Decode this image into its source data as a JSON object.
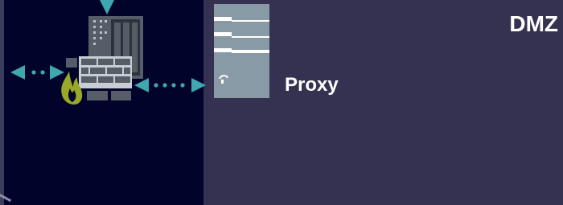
{
  "zones": {
    "internal": {
      "background": "#02032a"
    },
    "dmz": {
      "label": "DMZ",
      "background": "#343250"
    }
  },
  "nodes": {
    "firewall": {
      "icon": "firewall-server-icon",
      "accent": "#99a829"
    },
    "proxy": {
      "label": "Proxy",
      "icon": "proxy-server-icon",
      "tile_color": "#889aa6"
    }
  },
  "connectors": {
    "color": "#3fa7b0",
    "items": [
      {
        "name": "inbound-arrow-top",
        "style": "arrow-down"
      },
      {
        "name": "link-left",
        "style": "dotted-bidirectional"
      },
      {
        "name": "link-firewall-to-proxy",
        "style": "dotted-bidirectional"
      }
    ]
  }
}
